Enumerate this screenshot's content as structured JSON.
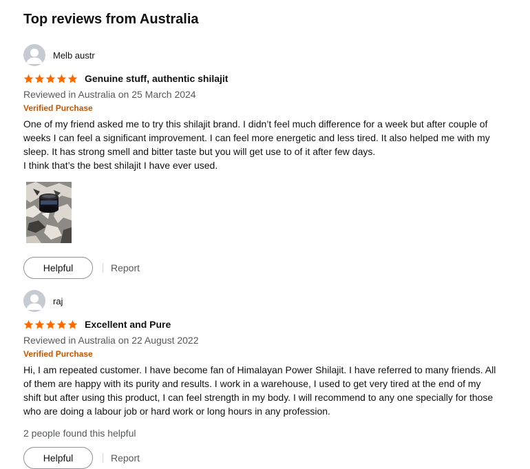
{
  "section_title": "Top reviews from Australia",
  "reviews": [
    {
      "profile_name": "Melb austr",
      "rating": 5,
      "title": "Genuine stuff, authentic shilajit",
      "date": "Reviewed in Australia on 25 March 2024",
      "verified": "Verified Purchase",
      "body": [
        "One of my friend asked me to try this shilajit brand. I didn’t feel much difference for a week but after couple of weeks I can feel a significant improvement. I can feel more energetic and less tired. It also helped me with my sleep. It has strong smell and bitter taste but you will get use to of it after few days.",
        "I think that’s the best shilajit I have ever used."
      ],
      "helpful_label": "Helpful",
      "report_label": "Report"
    },
    {
      "profile_name": "raj",
      "rating": 5,
      "title": "Excellent and Pure",
      "date": "Reviewed in Australia on 22 August 2022",
      "verified": "Verified Purchase",
      "body": [
        "Hi, I am repeated customer. I have become fan of Himalayan Power Shilajit. I have referred to many friends. All of them are happy with its purity and results. I work in a warehouse, I used to get very tired at the end of my shift but after using this product, I can feel strength in my body. I will recommend to any one specially for those who are doing a labour job or hard work or long hours in any profession."
      ],
      "helpful_count": "2 people found this helpful",
      "helpful_label": "Helpful",
      "report_label": "Report"
    }
  ],
  "colors": {
    "star": "#ff6a00",
    "verified": "#c45500",
    "muted_text": "#565959",
    "avatar_bg": "#c5cbd1"
  },
  "icons": {
    "avatar": "person-avatar-icon",
    "star": "star-icon"
  }
}
